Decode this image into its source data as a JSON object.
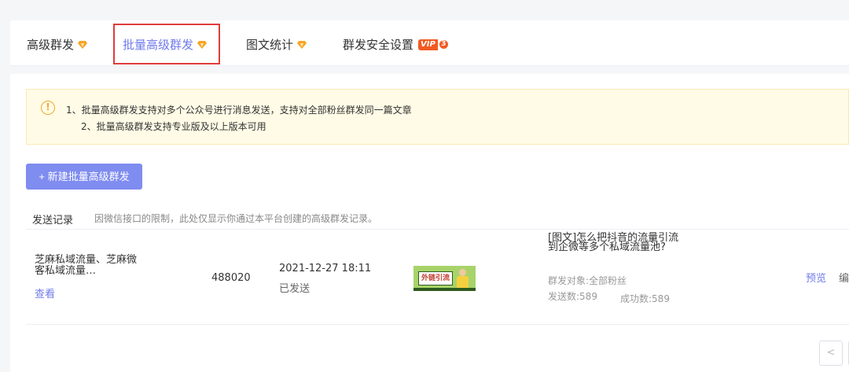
{
  "tabs": [
    {
      "label": "高级群发",
      "badge": "diamond-icon",
      "active": false
    },
    {
      "label": "批量高级群发",
      "badge": "diamond-icon",
      "active": true
    },
    {
      "label": "图文统计",
      "badge": "diamond-icon",
      "active": false
    },
    {
      "label": "群发安全设置",
      "badge": "vip-badge",
      "active": false
    }
  ],
  "vip_badge": {
    "text": "VIP",
    "level": "3"
  },
  "notice": {
    "icon_text": "!",
    "line1": "1、批量高级群发支持对多个公众号进行消息发送，支持对全部粉丝群发同一篇文章",
    "line2": "2、批量高级群发支持专业版及以上版本可用"
  },
  "new_button": "+ 新建批量高级群发",
  "records": {
    "label": "发送记录",
    "hint": "因微信接口的限制，此处仅显示你通过本平台创建的高级群发记录。"
  },
  "row": {
    "account_name": "芝麻私域流量、芝麻微客私域流量…",
    "view_link": "查看",
    "fans": "488020",
    "time": "2021-12-27 18:11",
    "status": "已发送",
    "thumb_text": "外链引流",
    "article_title": "[图文]怎么把抖音的流量引流到企微等多个私域流量池?",
    "target": "群发对象:全部粉丝",
    "sent": "发送数:589",
    "success": "成功数:589",
    "preview": "预览",
    "edit": "编"
  },
  "pager": {
    "prev": "<"
  },
  "colors": {
    "accent": "#6f7bea",
    "button": "#7f8cf0",
    "highlight": "#e03b3b",
    "notice_bg": "#fffbe6",
    "warning": "#f2a92c"
  }
}
